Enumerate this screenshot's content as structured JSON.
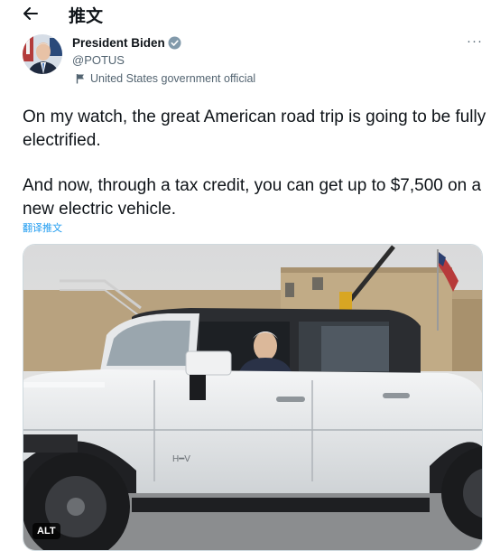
{
  "header": {
    "back_icon": "arrow-left-icon",
    "title": "推文"
  },
  "author": {
    "name": "President Biden",
    "handle": "@POTUS",
    "verified_icon": "verified-badge-icon",
    "label": "United States government official",
    "label_icon": "flag-icon",
    "more_icon": "more-options-icon",
    "more_glyph": "···"
  },
  "tweet": {
    "paragraph_1": "On my watch, the great American road trip is going to be fully electrified.",
    "paragraph_2": "And now, through a tax credit, you can get up to $7,500 on a new electric vehicle.",
    "translate_link": "翻译推文"
  },
  "media": {
    "alt_badge": "ALT",
    "truck_badge": "H━V"
  },
  "colors": {
    "text": "#0f1419",
    "secondary": "#536471",
    "accent": "#1d9bf0"
  }
}
